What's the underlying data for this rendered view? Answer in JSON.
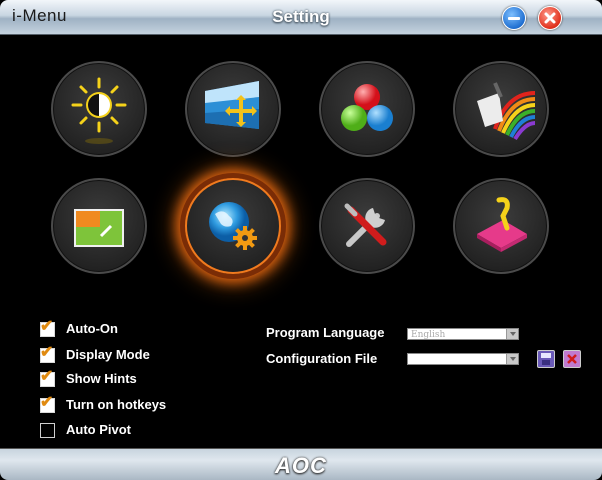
{
  "window": {
    "app_name": "i-Menu",
    "title": "Setting"
  },
  "title_buttons": [
    "minimize-icon",
    "close-icon"
  ],
  "tiles": [
    {
      "icon": "brightness-contrast-icon",
      "selected": false
    },
    {
      "icon": "image-setup-icon",
      "selected": false
    },
    {
      "icon": "color-rgb-icon",
      "selected": false
    },
    {
      "icon": "picture-boost-icon",
      "selected": false
    },
    {
      "icon": "osd-setup-icon",
      "selected": false
    },
    {
      "icon": "settings-globe-icon",
      "selected": true
    },
    {
      "icon": "tools-icon",
      "selected": false
    },
    {
      "icon": "exit-icon",
      "selected": false
    }
  ],
  "options": [
    {
      "label": "Auto-On",
      "checked": true
    },
    {
      "label": "Display Mode",
      "checked": true
    },
    {
      "label": "Show Hints",
      "checked": true
    },
    {
      "label": "Turn on hotkeys",
      "checked": true
    },
    {
      "label": "Auto Pivot",
      "checked": false
    }
  ],
  "program_language": {
    "label": "Program Language",
    "value": "English"
  },
  "configuration_file": {
    "label": "Configuration File",
    "value": ""
  },
  "footer": {
    "logo": "AOC"
  },
  "colors": {
    "accent": "#f07a1e",
    "check": "#e08a10",
    "titlebar": "#c9d6e2"
  }
}
